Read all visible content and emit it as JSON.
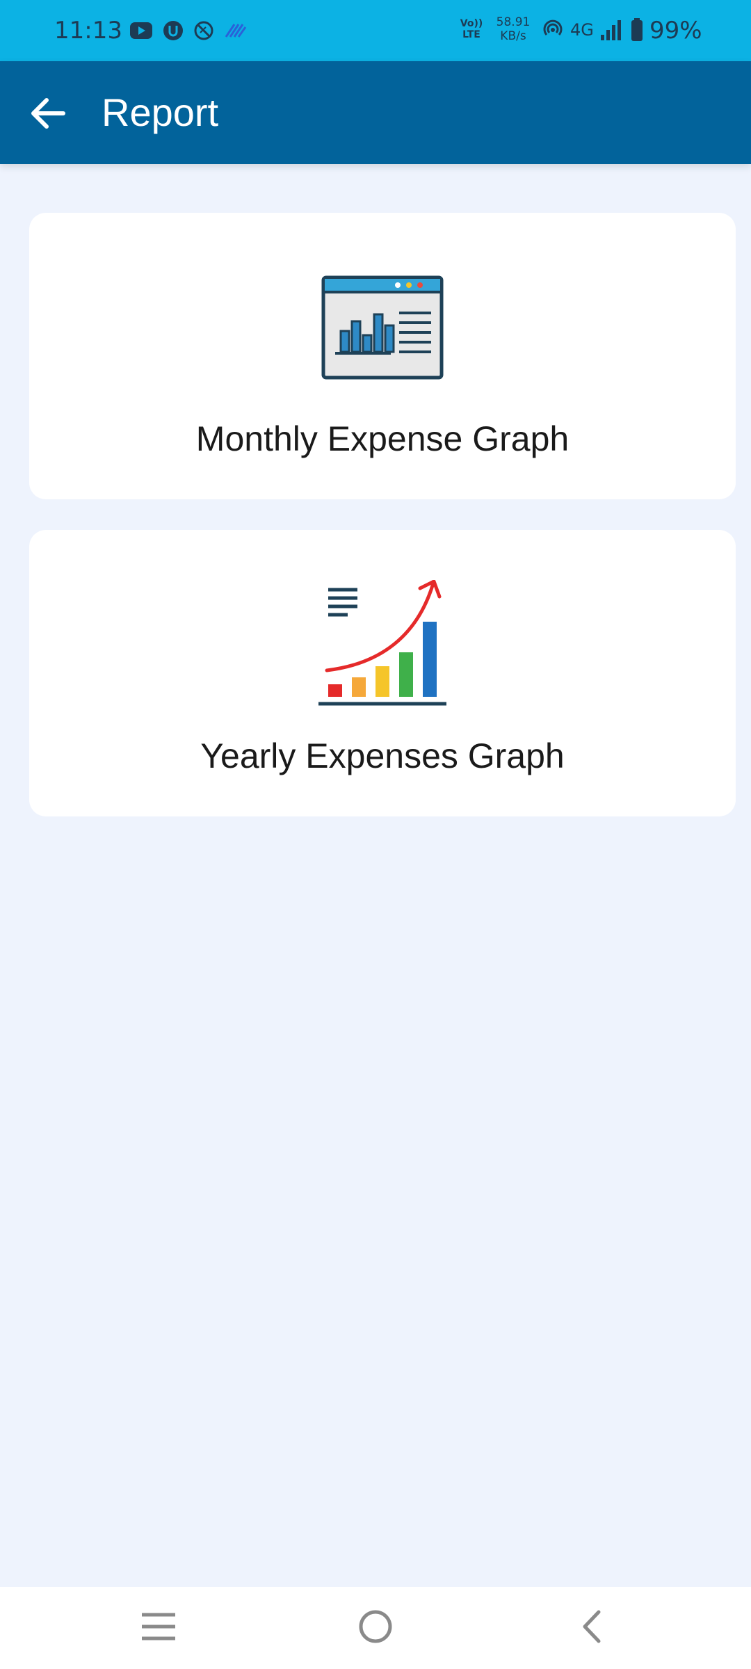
{
  "status_bar": {
    "time": "11:13",
    "volte": "Vo)) LTE",
    "speed_value": "58.91",
    "speed_unit": "KB/s",
    "network": "4G",
    "battery": "99%",
    "left_icons": [
      "youtube-icon",
      "u-app-icon",
      "no-disturb-icon",
      "signal-waves-icon"
    ]
  },
  "app_bar": {
    "title": "Report",
    "back_icon": "arrow-left-icon"
  },
  "cards": [
    {
      "label": "Monthly Expense Graph",
      "icon": "monthly-report-icon"
    },
    {
      "label": "Yearly Expenses Graph",
      "icon": "yearly-growth-chart-icon"
    }
  ],
  "nav_bar": {
    "buttons": [
      "menu-icon",
      "home-circle-icon",
      "back-chevron-icon"
    ]
  },
  "colors": {
    "status_bar": "#0cb2e4",
    "app_bar": "#02639b",
    "background": "#eef3fd",
    "card": "#ffffff"
  }
}
